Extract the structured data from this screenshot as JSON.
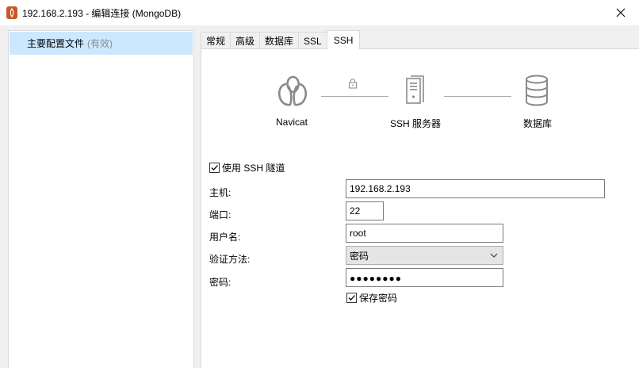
{
  "window": {
    "title": "192.168.2.193 - 编辑连接 (MongoDB)",
    "accent_color": "#cce8ff",
    "app_icon_color": "#c8592a"
  },
  "sidebar": {
    "items": [
      {
        "label": "主要配置文件",
        "status": "(有效)"
      }
    ]
  },
  "tabs": [
    {
      "label": "常规"
    },
    {
      "label": "高级"
    },
    {
      "label": "数据库"
    },
    {
      "label": "SSL"
    },
    {
      "label": "SSH",
      "active": true
    }
  ],
  "diagram": {
    "client": "Navicat",
    "server": "SSH 服务器",
    "database": "数据库"
  },
  "ssh": {
    "use_tunnel_label": "使用 SSH 隧道",
    "use_tunnel_checked": true,
    "host_label": "主机:",
    "host_value": "192.168.2.193",
    "port_label": "端口:",
    "port_value": "22",
    "user_label": "用户名:",
    "user_value": "root",
    "auth_label": "验证方法:",
    "auth_value": "密码",
    "password_label": "密码:",
    "password_masked": "●●●●●●●●",
    "save_password_label": "保存密码",
    "save_password_checked": true
  }
}
